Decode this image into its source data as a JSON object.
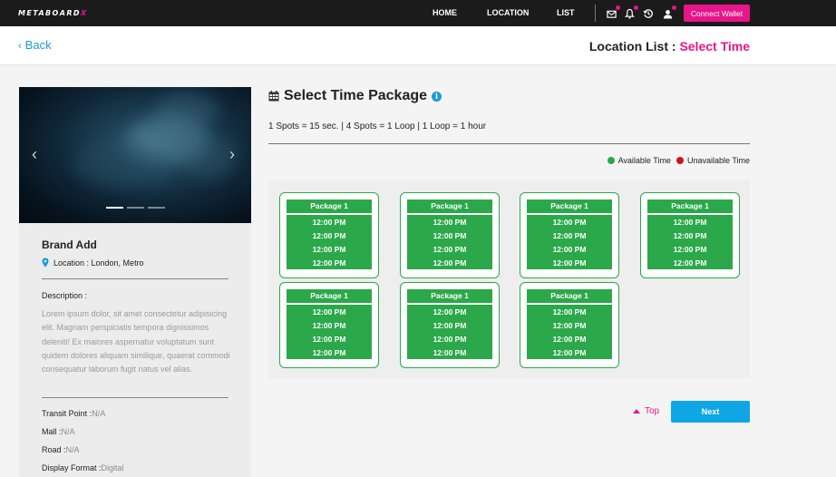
{
  "navbar": {
    "logo_main": "METABOARD",
    "logo_accent": "X",
    "links": [
      "HOME",
      "LOCATION",
      "LIST"
    ],
    "icons": [
      "mail-icon",
      "bell-icon",
      "history-icon",
      "user-icon"
    ],
    "connect_label": "Connect Wallet"
  },
  "header": {
    "back_label": "Back",
    "title_prefix": "Location List :",
    "title_accent": "Select Time"
  },
  "colors": {
    "brand_pink": "#e8158a",
    "link_blue": "#1a9bd7",
    "available_green": "#2ba84a",
    "unavailable_red": "#d3121c",
    "next_blue": "#0fa6e6"
  },
  "location_card": {
    "brand_name": "Brand Add",
    "location": "Location : London, Metro",
    "description_label": "Description :",
    "description": "Lorem ipsum dolor, sit amet consectetur adipisicing elit. Magnam perspiciatis tempora dignissimos deleniti! Ex maiores aspernatur voluptatum sunt quidem dolores aliquam similique, quaerat commodi consequatur laborum fugit natus vel alias.",
    "carousel_slides": 3,
    "carousel_active": 1,
    "details": [
      {
        "label": "Transit Point :",
        "value": "N/A"
      },
      {
        "label": "Mall :",
        "value": "N/A"
      },
      {
        "label": "Road :",
        "value": "N/A"
      },
      {
        "label": "Display Format :",
        "value": "Digital"
      }
    ]
  },
  "main": {
    "title": "Select Time Package",
    "subtitle": "1 Spots = 15 sec. | 4 Spots = 1 Loop | 1 Loop = 1 hour",
    "legend_available": "Available Time",
    "legend_unavailable": "Unavailable Time",
    "packages": [
      {
        "title": "Package 1",
        "times": [
          "12:00 PM",
          "12:00 PM",
          "12:00 PM",
          "12:00 PM"
        ]
      },
      {
        "title": "Package 1",
        "times": [
          "12:00 PM",
          "12:00 PM",
          "12:00 PM",
          "12:00 PM"
        ]
      },
      {
        "title": "Package 1",
        "times": [
          "12:00 PM",
          "12:00 PM",
          "12:00 PM",
          "12:00 PM"
        ]
      },
      {
        "title": "Package 1",
        "times": [
          "12:00 PM",
          "12:00 PM",
          "12:00 PM",
          "12:00 PM"
        ]
      },
      {
        "title": "Package 1",
        "times": [
          "12:00 PM",
          "12:00 PM",
          "12:00 PM",
          "12:00 PM"
        ]
      },
      {
        "title": "Package 1",
        "times": [
          "12:00 PM",
          "12:00 PM",
          "12:00 PM",
          "12:00 PM"
        ]
      },
      {
        "title": "Package 1",
        "times": [
          "12:00 PM",
          "12:00 PM",
          "12:00 PM",
          "12:00 PM"
        ]
      }
    ],
    "top_label": "Top",
    "next_label": "Next"
  }
}
